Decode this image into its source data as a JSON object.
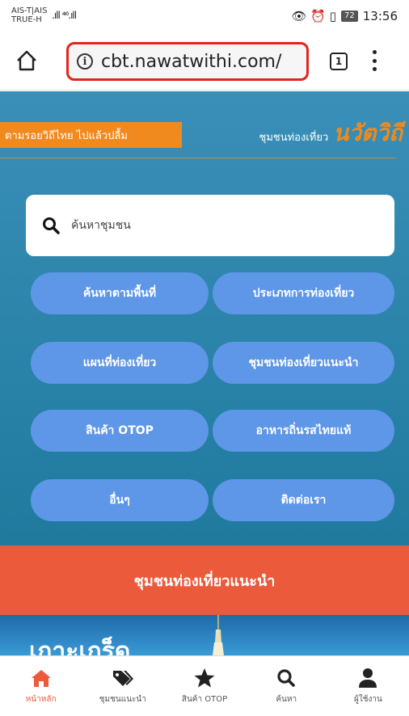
{
  "status_bar": {
    "carrier_line1": "AIS-T|AIS",
    "carrier_line2": "TRUE-H",
    "signal": ".ıll ⁴⁶.ıll",
    "icons": "👁 ⏰ ▯",
    "battery": "72",
    "time": "13:56"
  },
  "browser": {
    "url": "cbt.nawatwithi.com/",
    "tab_count": "1"
  },
  "header": {
    "banner_text": "ตามรอยวิถีไทย ไปแล้วปลื้ม",
    "brand_sub": "ชุมชนท่องเที่ยว",
    "brand_name": "นวัตวิถี"
  },
  "search": {
    "placeholder": "ค้นหาชุมชน"
  },
  "menu_buttons": [
    {
      "label": "ค้นหาตามพื้นที่"
    },
    {
      "label": "ประเภทการท่องเที่ยว"
    },
    {
      "label": "แผนที่ท่องเที่ยว"
    },
    {
      "label": "ชุมชนท่องเที่ยวแนะนำ"
    },
    {
      "label": "สินค้า OTOP"
    },
    {
      "label": "อาหารถิ่นรสไทยแท้"
    },
    {
      "label": "อื่นๆ"
    },
    {
      "label": "ติดต่อเรา"
    }
  ],
  "section": {
    "title": "ชุมชนท่องเที่ยวแนะนำ",
    "featured_title": "เกาะเกร็ด"
  },
  "bottom_nav": [
    {
      "label": "หน้าหลัก",
      "icon": "home-icon",
      "active": true
    },
    {
      "label": "ชุมชนแนะนำ",
      "icon": "tags-icon"
    },
    {
      "label": "สินค้า OTOP",
      "icon": "star-icon"
    },
    {
      "label": "ค้นหา",
      "icon": "search-icon"
    },
    {
      "label": "ผู้ใช้งาน",
      "icon": "user-icon"
    }
  ],
  "colors": {
    "accent": "#ec5a3c",
    "orange": "#f08a1e",
    "button": "#5e96e8",
    "url_highlight": "#e0251c"
  }
}
